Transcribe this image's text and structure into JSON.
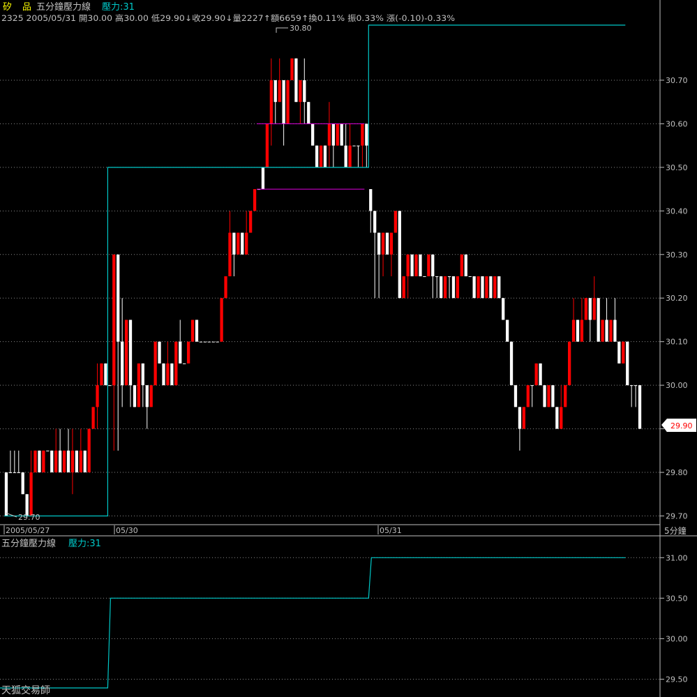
{
  "header": {
    "name_part1": "矽",
    "name_part2": "品",
    "study_name": "五分鐘壓力線",
    "study_value": "壓力:31",
    "quote": "2325 2005/05/31 開30.00 高30.00 低29.90↓收29.90↓量2227↑額6659↑換0.11% 振0.33% 漲(-0.10)-0.33%"
  },
  "lower_panel": {
    "title": "五分鐘壓力線",
    "value_label": "壓力:31",
    "watermark": "天狐交易師"
  },
  "x_axis": {
    "labels": [
      "2005/05/27",
      "05/30",
      "05/31"
    ],
    "period": "5分鐘"
  },
  "annotations": {
    "high_label": "30.80",
    "low_label": "29.70",
    "last_price": "29.90"
  },
  "colors": {
    "up": "#ff0000",
    "down": "#ffffff",
    "resistance": "#00c8c8",
    "box": "#e000e0",
    "grid": "#8a8a8a",
    "last_price_box": "#ffffff",
    "last_price_text": "#ff0000"
  },
  "chart_data": [
    {
      "type": "candlestick",
      "y_ticks": [
        "30.70",
        "30.60",
        "30.50",
        "30.40",
        "30.30",
        "30.20",
        "30.10",
        "30.00",
        "29.90",
        "29.80",
        "29.70"
      ],
      "ylim": [
        29.68,
        30.82
      ],
      "candles": [
        [
          29.8,
          29.7,
          29.8,
          29.7
        ],
        [
          29.8,
          29.8,
          29.85,
          29.8
        ],
        [
          29.8,
          29.8,
          29.85,
          29.8
        ],
        [
          29.8,
          29.8,
          29.85,
          29.8
        ],
        [
          29.8,
          29.75,
          29.8,
          29.75
        ],
        [
          29.75,
          29.7,
          29.75,
          29.7
        ],
        [
          29.7,
          29.8,
          29.85,
          29.7
        ],
        [
          29.8,
          29.85,
          29.85,
          29.8
        ],
        [
          29.85,
          29.8,
          29.85,
          29.8
        ],
        [
          29.8,
          29.85,
          29.85,
          29.8
        ],
        [
          29.85,
          29.85,
          29.85,
          29.85
        ],
        [
          29.85,
          29.8,
          29.85,
          29.8
        ],
        [
          29.8,
          29.85,
          29.9,
          29.8
        ],
        [
          29.85,
          29.8,
          29.9,
          29.8
        ],
        [
          29.8,
          29.85,
          29.85,
          29.8
        ],
        [
          29.85,
          29.8,
          29.9,
          29.8
        ],
        [
          29.8,
          29.85,
          29.9,
          29.75
        ],
        [
          29.85,
          29.8,
          29.85,
          29.8
        ],
        [
          29.8,
          29.85,
          29.9,
          29.8
        ],
        [
          29.85,
          29.8,
          29.85,
          29.8
        ],
        [
          29.8,
          29.9,
          29.9,
          29.8
        ],
        [
          29.9,
          29.95,
          29.95,
          29.9
        ],
        [
          29.95,
          30.0,
          30.05,
          29.9
        ],
        [
          30.0,
          30.05,
          30.05,
          30.0
        ],
        [
          30.05,
          30.0,
          30.05,
          30.0
        ],
        [
          30.0,
          30.0,
          30.0,
          30.0
        ],
        [
          30.0,
          30.3,
          30.3,
          29.85
        ],
        [
          30.3,
          30.1,
          30.2,
          29.85
        ],
        [
          30.1,
          30.0,
          30.2,
          29.95
        ],
        [
          30.0,
          30.15,
          30.15,
          30.0
        ],
        [
          30.15,
          30.0,
          30.15,
          29.95
        ],
        [
          30.0,
          29.95,
          30.0,
          29.95
        ],
        [
          29.95,
          30.05,
          30.05,
          29.95
        ],
        [
          30.05,
          30.0,
          30.05,
          29.95
        ],
        [
          30.0,
          29.95,
          30.0,
          29.9
        ],
        [
          29.95,
          30.0,
          30.0,
          29.95
        ],
        [
          30.0,
          30.1,
          30.1,
          30.0
        ],
        [
          30.1,
          30.05,
          30.1,
          30.05
        ],
        [
          30.05,
          30.0,
          30.05,
          30.0
        ],
        [
          30.0,
          30.05,
          30.1,
          30.0
        ],
        [
          30.05,
          30.0,
          30.05,
          30.0
        ],
        [
          30.0,
          30.1,
          30.1,
          30.0
        ],
        [
          30.1,
          30.05,
          30.15,
          30.05
        ],
        [
          30.05,
          30.05,
          30.05,
          30.05
        ],
        [
          30.05,
          30.1,
          30.1,
          30.05
        ],
        [
          30.1,
          30.15,
          30.15,
          30.1
        ],
        [
          30.15,
          30.1,
          30.15,
          30.1
        ],
        [
          30.1,
          30.1,
          30.1,
          30.1
        ],
        [
          30.1,
          30.1,
          30.1,
          30.1
        ],
        [
          30.1,
          30.1,
          30.1,
          30.1
        ],
        [
          30.1,
          30.1,
          30.1,
          30.1
        ],
        [
          30.1,
          30.1,
          30.1,
          30.1
        ],
        [
          30.1,
          30.2,
          30.2,
          30.1
        ],
        [
          30.2,
          30.25,
          30.25,
          30.2
        ],
        [
          30.25,
          30.35,
          30.4,
          30.25
        ],
        [
          30.35,
          30.3,
          30.35,
          30.25
        ],
        [
          30.3,
          30.35,
          30.35,
          30.3
        ],
        [
          30.35,
          30.3,
          30.35,
          30.3
        ],
        [
          30.3,
          30.35,
          30.4,
          30.3
        ],
        [
          30.35,
          30.4,
          30.4,
          30.35
        ],
        [
          30.4,
          30.45,
          30.45,
          30.4
        ],
        [
          30.45,
          30.45,
          30.45,
          30.45
        ],
        [
          30.5,
          30.45,
          30.5,
          30.45
        ],
        [
          30.5,
          30.6,
          30.6,
          30.5
        ],
        [
          30.6,
          30.7,
          30.75,
          30.55
        ],
        [
          30.7,
          30.65,
          30.7,
          30.6
        ],
        [
          30.65,
          30.7,
          30.75,
          30.65
        ],
        [
          30.7,
          30.6,
          30.7,
          30.55
        ],
        [
          30.6,
          30.7,
          30.7,
          30.6
        ],
        [
          30.7,
          30.75,
          30.75,
          30.7
        ],
        [
          30.75,
          30.65,
          30.75,
          30.65
        ],
        [
          30.65,
          30.7,
          30.7,
          30.6
        ],
        [
          30.7,
          30.65,
          30.75,
          30.6
        ],
        [
          30.65,
          30.6,
          30.65,
          30.6
        ],
        [
          30.6,
          30.55,
          30.6,
          30.55
        ],
        [
          30.55,
          30.5,
          30.55,
          30.5
        ],
        [
          30.5,
          30.55,
          30.55,
          30.5
        ],
        [
          30.55,
          30.5,
          30.55,
          30.5
        ],
        [
          30.55,
          30.6,
          30.65,
          30.5
        ],
        [
          30.6,
          30.55,
          30.6,
          30.5
        ],
        [
          30.55,
          30.6,
          30.6,
          30.55
        ],
        [
          30.6,
          30.55,
          30.6,
          30.55
        ],
        [
          30.55,
          30.5,
          30.6,
          30.5
        ],
        [
          30.5,
          30.55,
          30.6,
          30.5
        ],
        [
          30.55,
          30.55,
          30.55,
          30.55
        ],
        [
          30.55,
          30.55,
          30.55,
          30.5
        ],
        [
          30.55,
          30.6,
          30.6,
          30.5
        ],
        [
          30.6,
          30.55,
          30.6,
          30.5
        ],
        [
          30.45,
          30.4,
          30.45,
          30.35
        ],
        [
          30.4,
          30.35,
          30.4,
          30.2
        ],
        [
          30.35,
          30.3,
          30.35,
          30.2
        ],
        [
          30.3,
          30.35,
          30.35,
          30.25
        ],
        [
          30.35,
          30.3,
          30.35,
          30.3
        ],
        [
          30.3,
          30.35,
          30.35,
          30.25
        ],
        [
          30.35,
          30.4,
          30.4,
          30.35
        ],
        [
          30.4,
          30.2,
          30.4,
          30.2
        ],
        [
          30.2,
          30.25,
          30.25,
          30.2
        ],
        [
          30.25,
          30.3,
          30.3,
          30.2
        ],
        [
          30.3,
          30.25,
          30.3,
          30.25
        ],
        [
          30.25,
          30.3,
          30.3,
          30.25
        ],
        [
          30.3,
          30.25,
          30.3,
          30.25
        ],
        [
          30.25,
          30.25,
          30.25,
          30.25
        ],
        [
          30.25,
          30.3,
          30.3,
          30.25
        ],
        [
          30.3,
          30.25,
          30.3,
          30.2
        ],
        [
          30.25,
          30.25,
          30.25,
          30.2
        ],
        [
          30.25,
          30.2,
          30.25,
          30.2
        ],
        [
          30.2,
          30.25,
          30.25,
          30.2
        ],
        [
          30.25,
          30.25,
          30.25,
          30.2
        ],
        [
          30.25,
          30.2,
          30.25,
          30.2
        ],
        [
          30.2,
          30.25,
          30.25,
          30.2
        ],
        [
          30.25,
          30.3,
          30.3,
          30.25
        ],
        [
          30.3,
          30.25,
          30.3,
          30.25
        ],
        [
          30.25,
          30.25,
          30.25,
          30.25
        ],
        [
          30.25,
          30.2,
          30.25,
          30.2
        ],
        [
          30.2,
          30.25,
          30.25,
          30.2
        ],
        [
          30.25,
          30.2,
          30.25,
          30.2
        ],
        [
          30.2,
          30.25,
          30.25,
          30.2
        ],
        [
          30.25,
          30.2,
          30.25,
          30.2
        ],
        [
          30.2,
          30.25,
          30.25,
          30.2
        ],
        [
          30.25,
          30.2,
          30.25,
          30.2
        ],
        [
          30.2,
          30.15,
          30.2,
          30.15
        ],
        [
          30.15,
          30.1,
          30.15,
          30.1
        ],
        [
          30.1,
          30.0,
          30.1,
          30.0
        ],
        [
          30.0,
          29.95,
          30.0,
          29.95
        ],
        [
          29.95,
          29.9,
          29.95,
          29.85
        ],
        [
          29.9,
          29.95,
          29.95,
          29.9
        ],
        [
          29.95,
          30.0,
          30.0,
          29.95
        ],
        [
          30.0,
          30.0,
          30.0,
          29.95
        ],
        [
          30.0,
          30.05,
          30.05,
          30.0
        ],
        [
          30.05,
          30.0,
          30.05,
          30.0
        ],
        [
          30.0,
          29.95,
          30.0,
          29.95
        ],
        [
          29.95,
          30.0,
          30.0,
          29.95
        ],
        [
          30.0,
          29.95,
          30.0,
          29.95
        ],
        [
          29.95,
          29.9,
          29.95,
          29.9
        ],
        [
          29.9,
          29.95,
          30.0,
          29.9
        ],
        [
          29.95,
          30.0,
          30.0,
          29.95
        ],
        [
          30.0,
          30.1,
          30.1,
          30.0
        ],
        [
          30.1,
          30.15,
          30.2,
          30.1
        ],
        [
          30.15,
          30.1,
          30.15,
          30.1
        ],
        [
          30.1,
          30.15,
          30.2,
          30.1
        ],
        [
          30.15,
          30.2,
          30.2,
          30.15
        ],
        [
          30.2,
          30.15,
          30.2,
          30.1
        ],
        [
          30.15,
          30.2,
          30.25,
          30.15
        ],
        [
          30.2,
          30.1,
          30.2,
          30.1
        ],
        [
          30.1,
          30.15,
          30.15,
          30.1
        ],
        [
          30.15,
          30.1,
          30.2,
          30.1
        ],
        [
          30.1,
          30.15,
          30.15,
          30.1
        ],
        [
          30.15,
          30.1,
          30.2,
          30.1
        ],
        [
          30.1,
          30.05,
          30.1,
          30.05
        ],
        [
          30.05,
          30.1,
          30.1,
          30.05
        ],
        [
          30.1,
          30.0,
          30.1,
          30.0
        ],
        [
          30.0,
          30.0,
          30.0,
          29.95
        ],
        [
          30.0,
          30.0,
          30.0,
          29.95
        ],
        [
          30.0,
          29.9,
          30.0,
          29.9
        ]
      ],
      "resistance_steps": [
        {
          "from": 0,
          "to": 25,
          "value": 29.7
        },
        {
          "from": 25,
          "to": 88,
          "value": 30.5
        },
        {
          "from": 88,
          "to": 150,
          "value": 31.0
        }
      ],
      "box": {
        "upper": 30.6,
        "lower": 30.45,
        "from": 61,
        "to": 87
      }
    },
    {
      "type": "line",
      "name": "壓力",
      "y_ticks": [
        "31.00",
        "30.50",
        "30.00",
        "29.50"
      ],
      "ylim": [
        29.28,
        31.08
      ],
      "steps": [
        {
          "from": 0,
          "to": 25,
          "value": 29.2
        },
        {
          "from": 25,
          "to": 88,
          "value": 30.5
        },
        {
          "from": 88,
          "to": 150,
          "value": 31.0
        }
      ]
    }
  ]
}
